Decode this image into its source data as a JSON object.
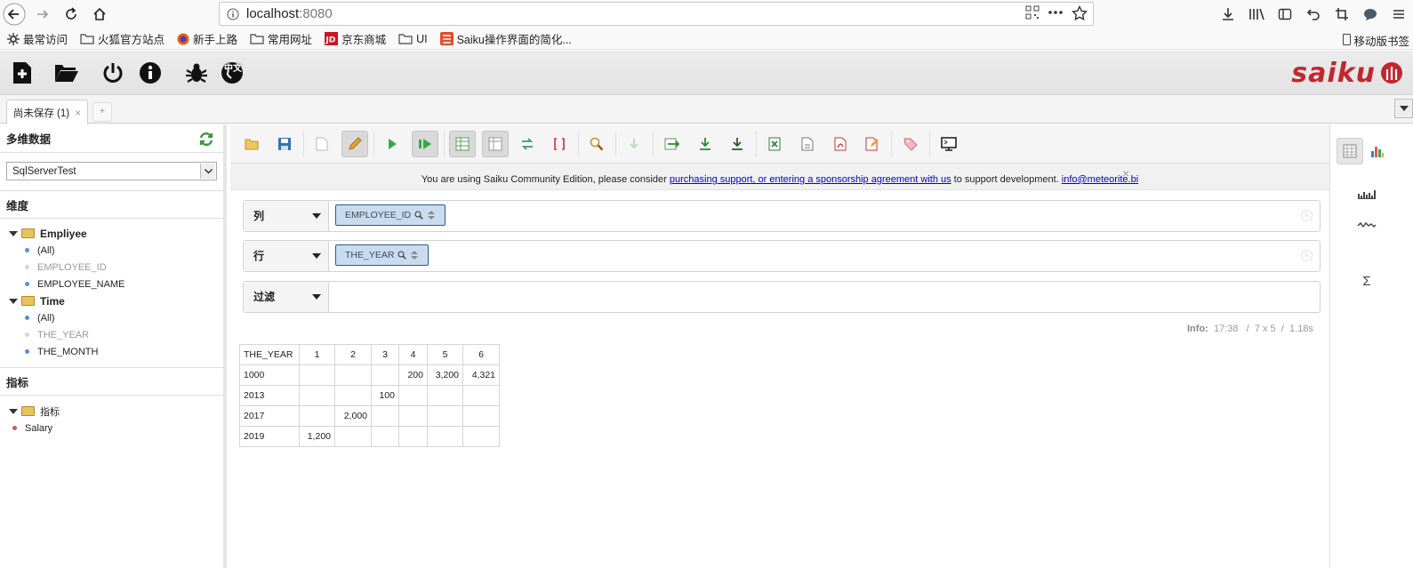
{
  "browser": {
    "url_host": "localhost",
    "url_port": ":8080",
    "bookmarks": [
      {
        "label": "最常访问",
        "icon": "gear-icon"
      },
      {
        "label": "火狐官方站点",
        "icon": "folder-icon"
      },
      {
        "label": "新手上路",
        "icon": "firefox-icon"
      },
      {
        "label": "常用网址",
        "icon": "folder-icon"
      },
      {
        "label": "京东商城",
        "icon": "jd-icon"
      },
      {
        "label": "UI",
        "icon": "folder-icon"
      },
      {
        "label": "Saiku操作界面的简化...",
        "icon": "jian-icon"
      }
    ],
    "mobile_bookmarks": "移动版书签"
  },
  "app": {
    "logo": "saiku",
    "tab_label": "尚未保存 (1)",
    "tab_close": "×",
    "tab_add": "+",
    "lang_badge": "中文"
  },
  "sidebar": {
    "cube_title": "多维数据",
    "cube_selected": "SqlServerTest",
    "dimensions_title": "维度",
    "dimensions": [
      {
        "name": "Empliyee",
        "levels": [
          {
            "label": "(All)",
            "disabled": false
          },
          {
            "label": "EMPLOYEE_ID",
            "disabled": true
          },
          {
            "label": "EMPLOYEE_NAME",
            "disabled": false
          }
        ]
      },
      {
        "name": "Time",
        "levels": [
          {
            "label": "(All)",
            "disabled": false
          },
          {
            "label": "THE_YEAR",
            "disabled": true
          },
          {
            "label": "THE_MONTH",
            "disabled": false
          }
        ]
      }
    ],
    "measures_title": "指标",
    "measure_group": "指标",
    "measures": [
      "Salary"
    ]
  },
  "notice": {
    "prefix": "You are using Saiku Community Edition, please consider ",
    "link": "purchasing support, or entering a sponsorship agreement with us",
    "middle": " to support development. ",
    "email": "info@meteorite.bi",
    "close": "×"
  },
  "axes": {
    "columns": {
      "label": "列",
      "pill": "EMPLOYEE_ID"
    },
    "rows": {
      "label": "行",
      "pill": "THE_YEAR"
    },
    "filter": {
      "label": "过滤"
    }
  },
  "info": {
    "label": "Info:",
    "time": "17:38",
    "size": "7 x 5",
    "duration": "1.18s"
  },
  "table": {
    "corner": "THE_YEAR",
    "columns": [
      "1",
      "2",
      "3",
      "4",
      "5",
      "6"
    ],
    "rows": [
      {
        "year": "1000",
        "cells": [
          "",
          "",
          "",
          "200",
          "3,200",
          "4,321"
        ]
      },
      {
        "year": "2013",
        "cells": [
          "",
          "",
          "100",
          "",
          "",
          ""
        ]
      },
      {
        "year": "2017",
        "cells": [
          "",
          "2,000",
          "",
          "",
          "",
          ""
        ]
      },
      {
        "year": "2019",
        "cells": [
          "1,200",
          "",
          "",
          "",
          "",
          ""
        ]
      }
    ]
  },
  "right_panel": {
    "sum_symbol": "Σ"
  }
}
